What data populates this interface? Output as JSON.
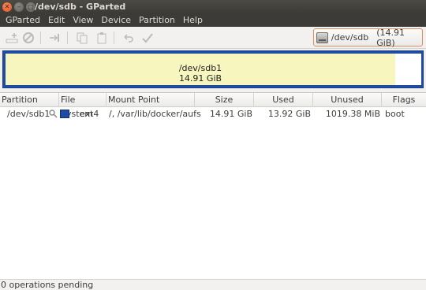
{
  "window": {
    "title": "/dev/sdb - GParted"
  },
  "menu": [
    "GParted",
    "Edit",
    "View",
    "Device",
    "Partition",
    "Help"
  ],
  "toolbar": {
    "icons": [
      "new-partition-icon",
      "delete-icon",
      "resize-move-icon",
      "copy-icon",
      "paste-icon",
      "undo-icon",
      "apply-icon"
    ]
  },
  "device": {
    "name": "/dev/sdb",
    "size": "(14.91 GiB)"
  },
  "disk_map": {
    "partition_name": "/dev/sdb1",
    "partition_size": "14.91 GiB"
  },
  "table": {
    "headers": [
      "Partition",
      "File System",
      "Mount Point",
      "Size",
      "Used",
      "Unused",
      "Flags"
    ],
    "rows": [
      {
        "partition": "/dev/sdb1",
        "filesystem": "ext4",
        "mount_point": "/, /var/lib/docker/aufs",
        "size": "14.91 GiB",
        "used": "13.92 GiB",
        "unused": "1019.38 MiB",
        "flags": "boot"
      }
    ]
  },
  "status": "0 operations pending",
  "colors": {
    "ext4": "#1f4ca3",
    "partition_fill": "#f7f6be",
    "accent": "#e08f5c"
  }
}
